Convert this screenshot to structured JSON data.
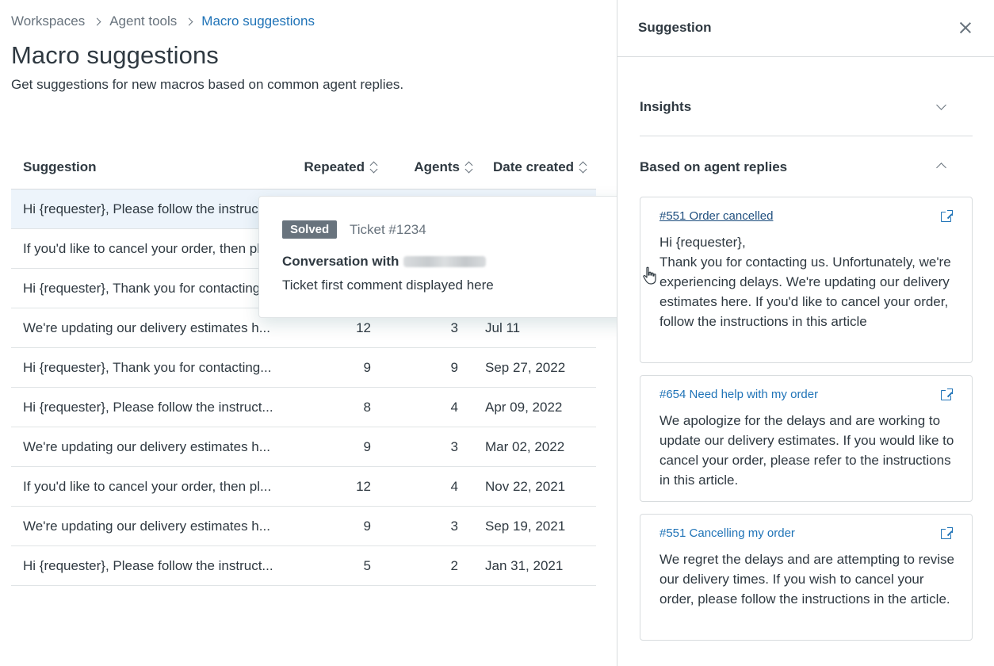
{
  "breadcrumb": {
    "items": [
      "Workspaces",
      "Agent tools"
    ],
    "current": "Macro suggestions"
  },
  "page": {
    "title": "Macro suggestions",
    "subtitle": "Get suggestions for new macros based on common agent replies."
  },
  "table": {
    "headers": {
      "suggestion": "Suggestion",
      "repeated": "Repeated",
      "agents": "Agents",
      "date": "Date created"
    },
    "rows": [
      {
        "suggestion": "Hi {requester}, Please follow the instructions...",
        "repeated": "",
        "agents": "",
        "date": ""
      },
      {
        "suggestion": "If you'd like to cancel your order, then please...",
        "repeated": "",
        "agents": "",
        "date": ""
      },
      {
        "suggestion": "Hi {requester}, Thank you for contacting...",
        "repeated": "",
        "agents": "",
        "date": ""
      },
      {
        "suggestion": "We're updating our delivery estimates h...",
        "repeated": "12",
        "agents": "3",
        "date": "Jul 11"
      },
      {
        "suggestion": "Hi {requester}, Thank you for contacting...",
        "repeated": "9",
        "agents": "9",
        "date": "Sep 27, 2022"
      },
      {
        "suggestion": "Hi {requester}, Please follow the instruct...",
        "repeated": "8",
        "agents": "4",
        "date": "Apr 09, 2022"
      },
      {
        "suggestion": "We're updating our delivery estimates h...",
        "repeated": "9",
        "agents": "3",
        "date": "Mar 02, 2022"
      },
      {
        "suggestion": "If you'd like to cancel your order, then pl...",
        "repeated": "12",
        "agents": "4",
        "date": "Nov 22, 2021"
      },
      {
        "suggestion": "We're updating our delivery estimates h...",
        "repeated": "9",
        "agents": "3",
        "date": "Sep 19, 2021"
      },
      {
        "suggestion": "Hi {requester}, Please follow the instruct...",
        "repeated": "5",
        "agents": "2",
        "date": "Jan 31, 2021"
      }
    ]
  },
  "popover": {
    "badge": "Solved",
    "ticket": "Ticket #1234",
    "conversation_label": "Conversation with",
    "comment": "Ticket first comment displayed here"
  },
  "panel": {
    "title": "Suggestion",
    "insights_title": "Insights",
    "based_title": "Based on agent replies",
    "cards": [
      {
        "link": "#551 Order cancelled",
        "body": [
          "Hi {requester},",
          "Thank you for contacting us. Unfortunately, we're experiencing delays. We're updating our delivery estimates here. If you'd like to cancel your order, follow the instructions in this article"
        ]
      },
      {
        "link": "#654 Need help with my order",
        "body": [
          "We apologize for the delays and are working to update our delivery estimates. If you would like to cancel your order, please refer to the instructions in this article."
        ]
      },
      {
        "link": "#551 Cancelling my order",
        "body": [
          "We regret the delays and are attempting to revise our delivery times. If you wish to cancel your order, please follow the instructions in the article."
        ]
      }
    ]
  },
  "colors": {
    "link": "#1f73b7",
    "text": "#2f3941",
    "muted": "#68737d",
    "row_highlight": "#edf4fb",
    "border": "#d8dcde"
  },
  "icons": [
    "chevron-right-icon",
    "sort-icon",
    "close-icon",
    "chevron-down-icon",
    "chevron-up-icon",
    "external-link-icon",
    "hand-cursor-icon"
  ]
}
